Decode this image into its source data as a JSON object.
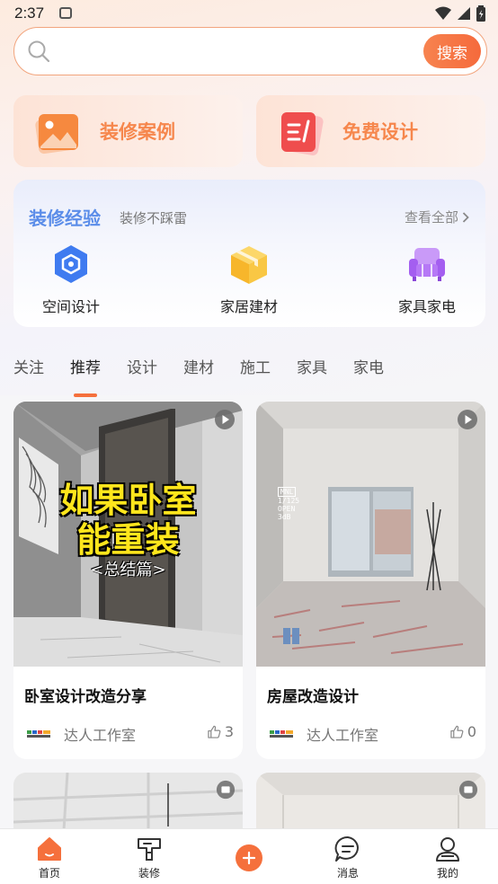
{
  "status_bar": {
    "time": "2:37"
  },
  "search": {
    "placeholder": "",
    "button_label": "搜索"
  },
  "feature_cards": [
    {
      "label": "装修案例",
      "icon": "image-icon"
    },
    {
      "label": "免费设计",
      "icon": "design-note-icon"
    }
  ],
  "experience": {
    "title": "装修经验",
    "subtitle": "装修不踩雷",
    "view_all": "查看全部",
    "items": [
      {
        "label": "空间设计",
        "icon": "space-design-icon"
      },
      {
        "label": "家居建材",
        "icon": "box-icon"
      },
      {
        "label": "家具家电",
        "icon": "sofa-icon"
      }
    ]
  },
  "tabs": [
    "关注",
    "推荐",
    "设计",
    "建材",
    "施工",
    "家具",
    "家电"
  ],
  "active_tab": "推荐",
  "feed": [
    {
      "title": "卧室设计改造分享",
      "author": "达人工作室",
      "likes": "3",
      "overlay_line1": "如果卧室",
      "overlay_line2": "能重装",
      "overlay_line3": "<总结篇>"
    },
    {
      "title": "房屋改造设计",
      "author": "达人工作室",
      "likes": "0",
      "cam_line1": "MNL",
      "cam_line2": "1/125",
      "cam_line3": "OPEN",
      "cam_line4": "3dB"
    }
  ],
  "bottom_nav": [
    {
      "label": "首页",
      "icon": "home-icon"
    },
    {
      "label": "装修",
      "icon": "decor-icon"
    },
    {
      "label": "",
      "icon": "add-icon"
    },
    {
      "label": "消息",
      "icon": "message-icon"
    },
    {
      "label": "我的",
      "icon": "profile-icon"
    }
  ],
  "colors": {
    "accent": "#f5703c",
    "exp_title": "#5b8de9",
    "feature_label": "#f6874d"
  }
}
